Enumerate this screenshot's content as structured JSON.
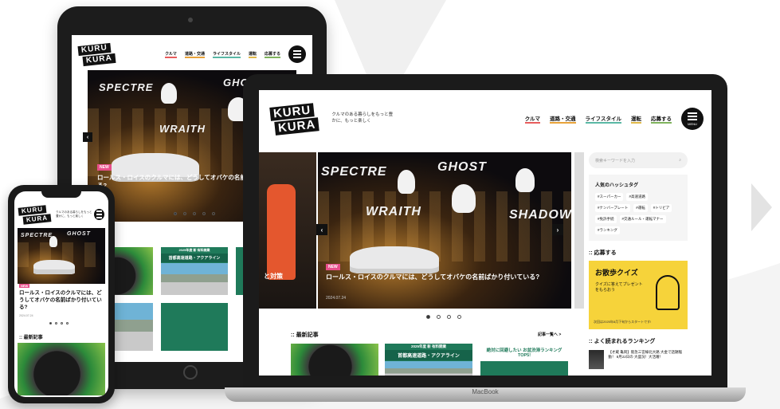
{
  "brand": {
    "logo_line1": "KURU",
    "logo_line2": "KURA",
    "tagline": "クルマのある暮らしをもっと豊かに、もっと楽しく"
  },
  "nav": [
    "クルマ",
    "道路・交通",
    "ライフスタイル",
    "運転",
    "応募する"
  ],
  "menu_label": "MENU",
  "hero": {
    "tag": "NEW",
    "caption": "ロールス・ロイスのクルマには、どうしてオバケの名前ばかり付いている?",
    "date": "2024.07.24",
    "ghost_words": [
      "SPECTRE",
      "GHOST",
      "WRAITH",
      "SHADOW"
    ],
    "prev_label": "‹",
    "next_label": "›",
    "side_caption": "と対策"
  },
  "latest": {
    "title": "最新記事",
    "more": "記事一覧へ >",
    "tablet_snippet_1": "2025年度 新 有料開業",
    "tablet_snippet_2": "首都高速道路・アクアライン",
    "tablet_snippet_3": "首都高速道路・アクアライン",
    "tablet_snippet_4": "絶対に回避したい お盆渋滞ランキング TOP5!"
  },
  "sidebar": {
    "search_placeholder": "検索キーワードを入力",
    "hashtag_title": "人気のハッシュタグ",
    "hashtags": [
      "#スーパーカー",
      "#高速道路",
      "#ナンバープレート",
      "#運転",
      "#トリビア",
      "#免許手続",
      "#交通ルール・運転マナー",
      "#ランキング"
    ],
    "apply_title": "応募する",
    "quiz_title": "お散歩クイズ",
    "quiz_text": "クイズに答えてプレゼントをもらおう",
    "quiz_footer": "次回は2025年8月下旬からスタートです!",
    "ranking_title": "よく読まれるランキング",
    "ranking_item": "【才蔵 亀岡】阪急三宮線北大路 大金で話題騒動！ 8月22日の 大盛況！大活躍！"
  },
  "phone": {
    "latest_title": "最新記事"
  },
  "device_label": "MacBook",
  "colors": {
    "accent_pink": "#e84f8a",
    "quiz_yellow": "#f6d33a",
    "green_band": "#1f7a5a"
  }
}
